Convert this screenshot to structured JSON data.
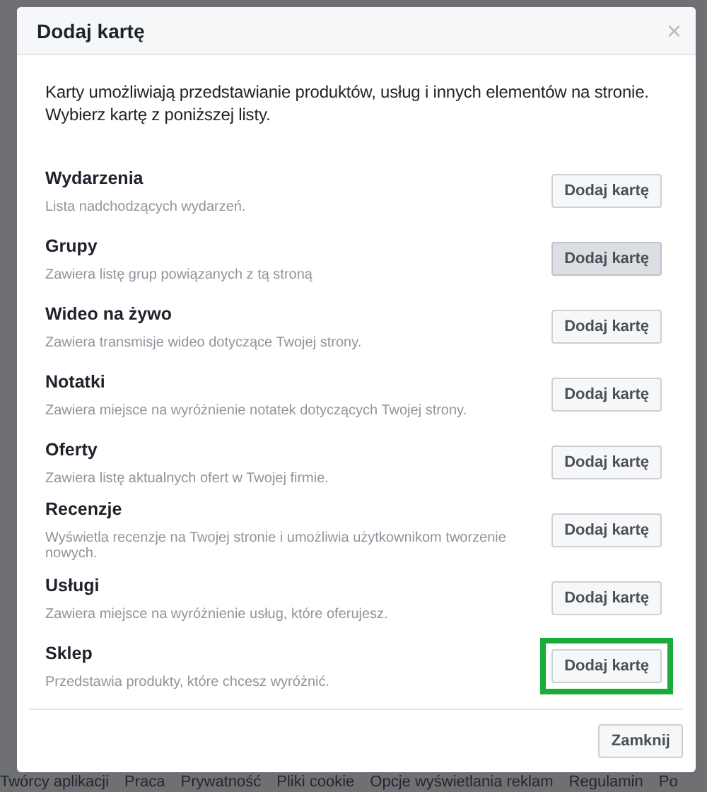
{
  "dialog": {
    "title": "Dodaj kartę",
    "close_icon": "×",
    "intro": "Karty umożliwiają przedstawianie produktów, usług i innych elementów na stronie. Wybierz kartę z poniższej listy.",
    "cards": [
      {
        "name": "Wydarzenia",
        "description": "Lista nadchodzących wydarzeń.",
        "button": "Dodaj kartę",
        "hovered": false,
        "highlighted": false
      },
      {
        "name": "Grupy",
        "description": "Zawiera listę grup powiązanych z tą stroną",
        "button": "Dodaj kartę",
        "hovered": true,
        "highlighted": false
      },
      {
        "name": "Wideo na żywo",
        "description": "Zawiera transmisje wideo dotyczące Twojej strony.",
        "button": "Dodaj kartę",
        "hovered": false,
        "highlighted": false
      },
      {
        "name": "Notatki",
        "description": "Zawiera miejsce na wyróżnienie notatek dotyczących Twojej strony.",
        "button": "Dodaj kartę",
        "hovered": false,
        "highlighted": false
      },
      {
        "name": "Oferty",
        "description": "Zawiera listę aktualnych ofert w Twojej firmie.",
        "button": "Dodaj kartę",
        "hovered": false,
        "highlighted": false
      },
      {
        "name": "Recenzje",
        "description": "Wyświetla recenzje na Twojej stronie i umożliwia użytkownikom tworzenie nowych.",
        "button": "Dodaj kartę",
        "hovered": false,
        "highlighted": false
      },
      {
        "name": "Usługi",
        "description": "Zawiera miejsce na wyróżnienie usług, które oferujesz.",
        "button": "Dodaj kartę",
        "hovered": false,
        "highlighted": false
      },
      {
        "name": "Sklep",
        "description": "Przedstawia produkty, które chcesz wyróżnić.",
        "button": "Dodaj kartę",
        "hovered": false,
        "highlighted": true
      }
    ],
    "close_button": "Zamknij"
  },
  "footer_links": [
    "Twórcy aplikacji",
    "Praca",
    "Prywatność",
    "Pliki cookie",
    "Opcje wyświetlania reklam",
    "Regulamin",
    "Po"
  ]
}
